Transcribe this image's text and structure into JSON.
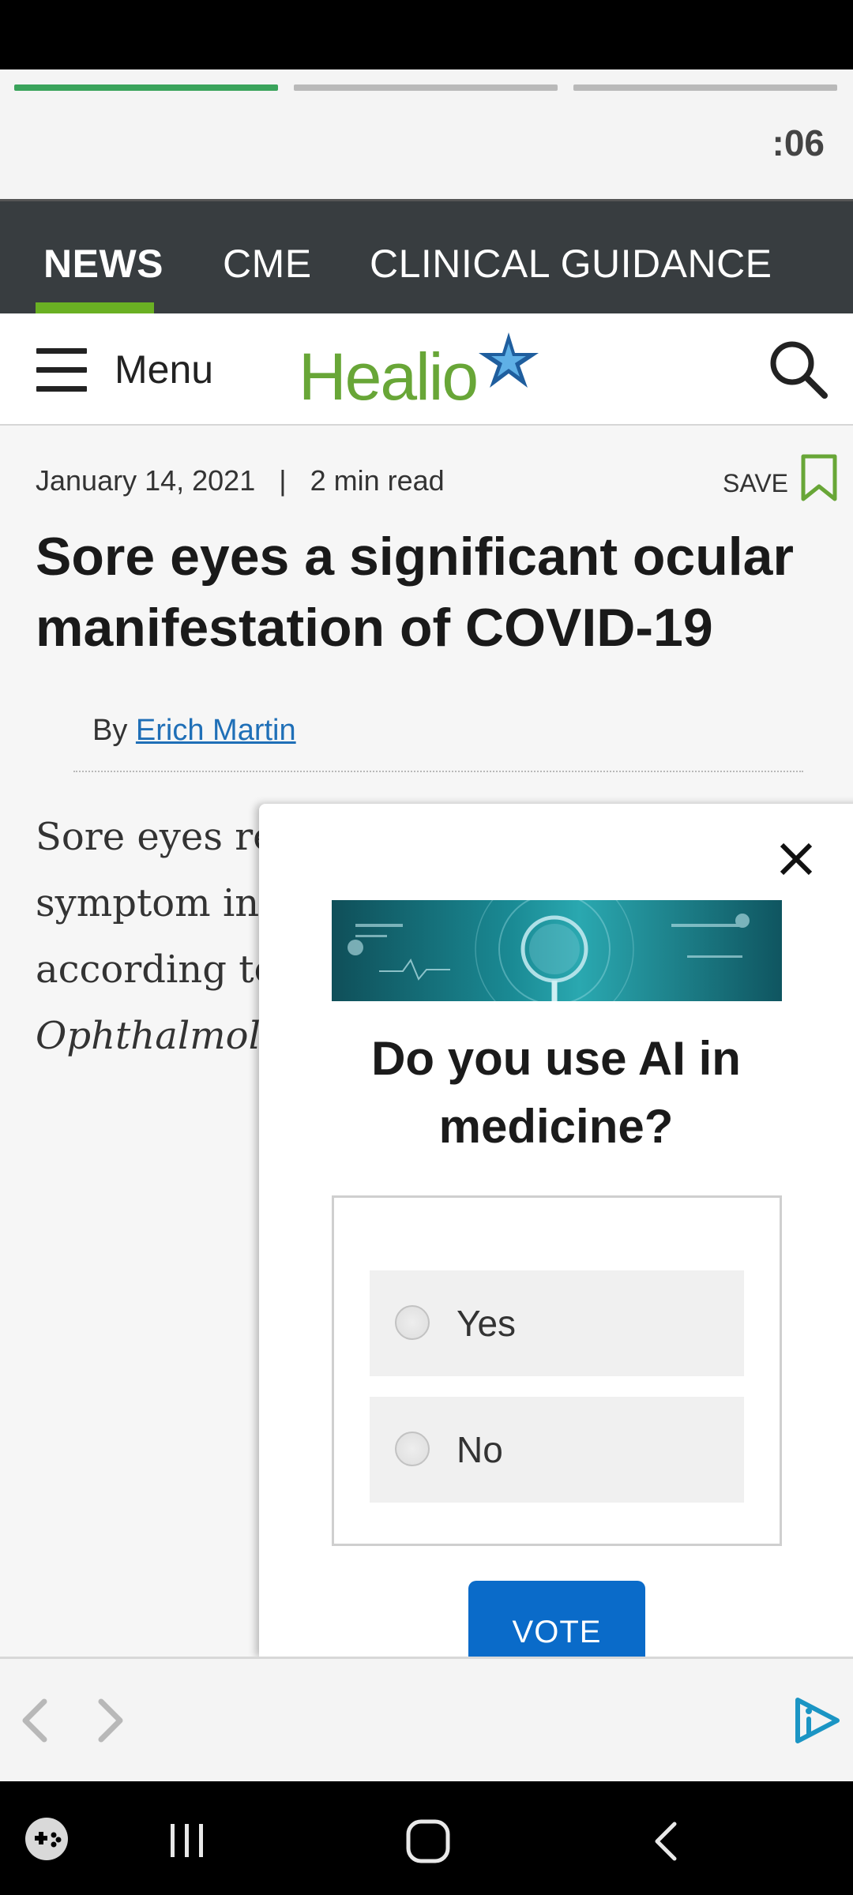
{
  "story": {
    "segments": [
      {
        "state": "active"
      },
      {
        "state": "inactive"
      },
      {
        "state": "inactive"
      }
    ],
    "timer": ":06"
  },
  "top_nav": {
    "tabs": [
      {
        "label": "NEWS",
        "active": true
      },
      {
        "label": "CME",
        "active": false
      },
      {
        "label": "CLINICAL GUIDANCE",
        "active": false
      }
    ],
    "accent": "#6ab023"
  },
  "header": {
    "menu_label": "Menu",
    "logo_text": "Healio",
    "icons": [
      "menu-icon",
      "search-icon"
    ]
  },
  "article": {
    "date": "January 14, 2021",
    "read_time": "2 min read",
    "save_label": "SAVE",
    "headline": "Sore eyes a significant ocular manifestation of COVID-19",
    "byline_prefix": "By",
    "author": "Erich Martin",
    "body_lines": [
      "Sore eyes re",
      "symptom in",
      "according to"
    ],
    "body_italic": "Ophthalmolo"
  },
  "poll": {
    "question": "Do you use AI in medicine?",
    "options": [
      {
        "label": "Yes"
      },
      {
        "label": "No"
      }
    ],
    "vote_label": "VOTE",
    "button_color": "#0a6bc9"
  },
  "colors": {
    "brand_green": "#68a637",
    "link_blue": "#1f6fb7",
    "nav_bg": "#383d40"
  }
}
